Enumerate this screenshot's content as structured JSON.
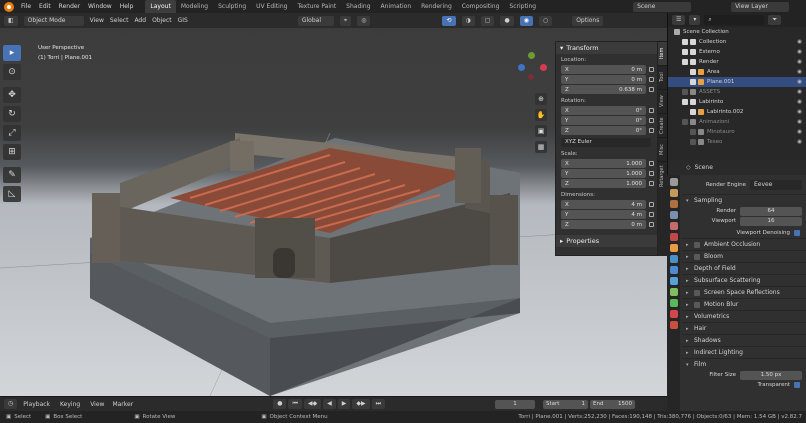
{
  "topbar": {
    "menus": [
      "File",
      "Edit",
      "Render",
      "Window",
      "Help"
    ],
    "workspaces": [
      "Layout",
      "Modeling",
      "Sculpting",
      "UV Editing",
      "Texture Paint",
      "Shading",
      "Animation",
      "Rendering",
      "Compositing",
      "Scripting"
    ],
    "active_workspace": "Layout",
    "scene_label": "Scene",
    "view_layer_label": "View Layer"
  },
  "viewport": {
    "mode": "Object Mode",
    "menus": [
      "View",
      "Select",
      "Add",
      "Object",
      "GIS"
    ],
    "transform_orientation": "Global",
    "options_label": "Options",
    "info_line1": "User Perspective",
    "info_line2": "(1) Torri | Plane.001"
  },
  "npanel": {
    "tabs": [
      "Item",
      "Tool",
      "View",
      "Create",
      "Misc",
      "Retarget"
    ],
    "transform_title": "Transform",
    "location_label": "Location:",
    "location": [
      {
        "axis": "X",
        "value": "0 m"
      },
      {
        "axis": "Y",
        "value": "0 m"
      },
      {
        "axis": "Z",
        "value": "0.638 m"
      }
    ],
    "rotation_label": "Rotation:",
    "rotation": [
      {
        "axis": "X",
        "value": "0°"
      },
      {
        "axis": "Y",
        "value": "0°"
      },
      {
        "axis": "Z",
        "value": "0°"
      }
    ],
    "rotation_mode": "XYZ Euler",
    "scale_label": "Scale:",
    "scale": [
      {
        "axis": "X",
        "value": "1.000"
      },
      {
        "axis": "Y",
        "value": "1.000"
      },
      {
        "axis": "Z",
        "value": "1.000"
      }
    ],
    "dimensions_label": "Dimensions:",
    "dimensions": [
      {
        "axis": "X",
        "value": "4 m"
      },
      {
        "axis": "Y",
        "value": "4 m"
      },
      {
        "axis": "Z",
        "value": "0 m"
      }
    ],
    "properties_title": "Properties"
  },
  "outliner": {
    "search_placeholder": "",
    "root": "Scene Collection",
    "items": [
      {
        "name": "Collection",
        "depth": 1,
        "dim": false,
        "sel": false,
        "color": "#d8d8d8"
      },
      {
        "name": "Esterno",
        "depth": 1,
        "dim": false,
        "sel": false,
        "color": "#d8d8d8"
      },
      {
        "name": "Render",
        "depth": 1,
        "dim": false,
        "sel": false,
        "color": "#d8d8d8"
      },
      {
        "name": "Area",
        "depth": 2,
        "dim": false,
        "sel": false,
        "color": "#e8a040"
      },
      {
        "name": "Plane.001",
        "depth": 2,
        "dim": false,
        "sel": true,
        "color": "#e8a040"
      },
      {
        "name": "ASSETS",
        "depth": 1,
        "dim": true,
        "sel": false,
        "color": "#888888"
      },
      {
        "name": "Labirinto",
        "depth": 1,
        "dim": false,
        "sel": false,
        "color": "#d8d8d8"
      },
      {
        "name": "Labirinto.002",
        "depth": 2,
        "dim": false,
        "sel": false,
        "color": "#e8a040"
      },
      {
        "name": "Animazioni",
        "depth": 1,
        "dim": true,
        "sel": false,
        "color": "#888888"
      },
      {
        "name": "Minotauro",
        "depth": 2,
        "dim": true,
        "sel": false,
        "color": "#888888"
      },
      {
        "name": "Teseo",
        "depth": 2,
        "dim": true,
        "sel": false,
        "color": "#888888"
      }
    ]
  },
  "properties": {
    "scene_label": "Scene",
    "render_engine_label": "Render Engine",
    "render_engine_value": "Eevee",
    "sampling_title": "Sampling",
    "render_label": "Render",
    "render_value": "64",
    "viewport_label": "Viewport",
    "viewport_value": "16",
    "viewport_denoising": "Viewport Denoising",
    "sections": [
      {
        "label": "Ambient Occlusion",
        "checkbox": true
      },
      {
        "label": "Bloom",
        "checkbox": true
      },
      {
        "label": "Depth of Field",
        "checkbox": false
      },
      {
        "label": "Subsurface Scattering",
        "checkbox": false
      },
      {
        "label": "Screen Space Reflections",
        "checkbox": true
      },
      {
        "label": "Motion Blur",
        "checkbox": true
      },
      {
        "label": "Volumetrics",
        "checkbox": false
      },
      {
        "label": "Hair",
        "checkbox": false
      },
      {
        "label": "Shadows",
        "checkbox": false
      },
      {
        "label": "Indirect Lighting",
        "checkbox": false
      },
      {
        "label": "Film",
        "checkbox": false
      }
    ],
    "filter_size_label": "Filter Size",
    "filter_size_value": "1.50 px",
    "transparent_label": "Transparent"
  },
  "timeline": {
    "menus": [
      "Playback",
      "Keying",
      "View",
      "Marker"
    ],
    "current_frame": "1",
    "start_label": "Start",
    "start_value": "1",
    "end_label": "End",
    "end_value": "1500"
  },
  "statusbar": {
    "select": "Select",
    "box_select": "Box Select",
    "rotate_view": "Rotate View",
    "context_menu": "Object Context Menu",
    "stats": "Torri | Plane.001 | Verts:252,230 | Faces:190,148 | Tris:380,776 | Objects:0/63 | Mem: 1.54 GB | v2.82.7"
  },
  "colors": {
    "accent": "#4772b3",
    "blender_orange": "#e87d0d",
    "selection": "#334d80"
  }
}
